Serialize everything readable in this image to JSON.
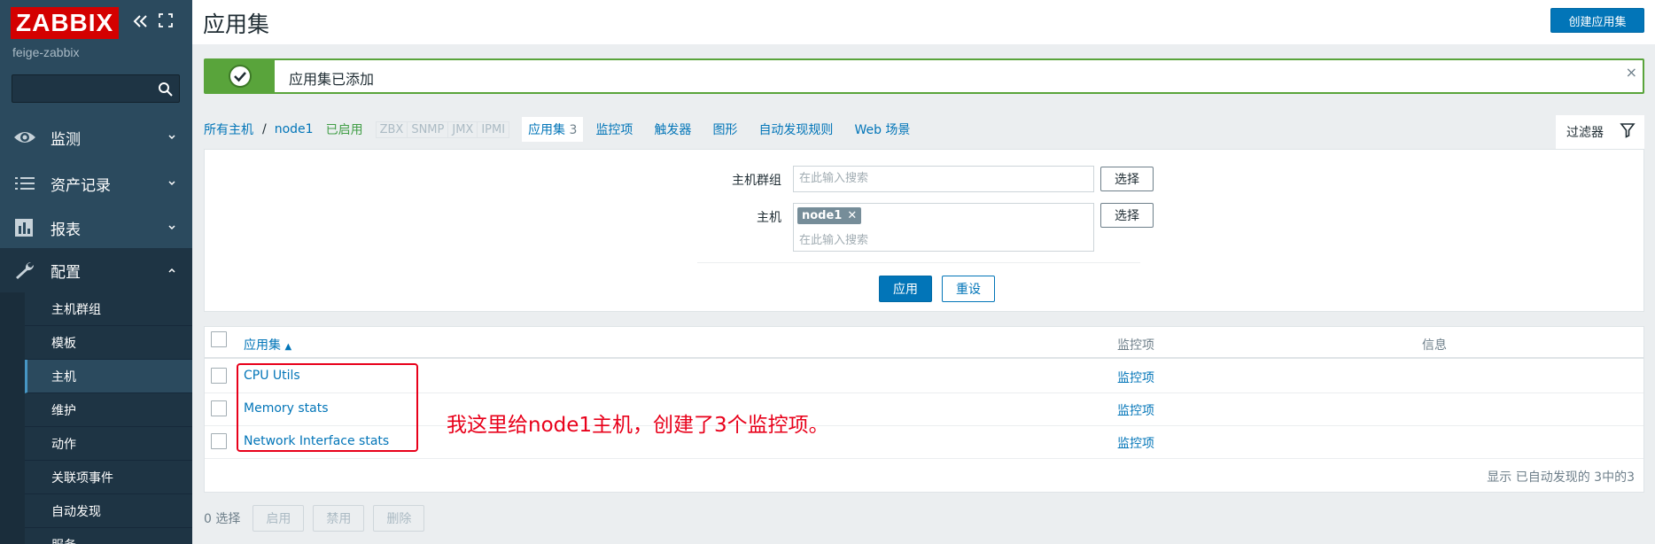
{
  "sidebar": {
    "logo": "ZABBIX",
    "server_name": "feige-zabbix",
    "search_placeholder": "",
    "menu": [
      {
        "label": "监测",
        "icon": "eye-icon"
      },
      {
        "label": "资产记录",
        "icon": "list-icon"
      },
      {
        "label": "报表",
        "icon": "bar-chart-icon"
      },
      {
        "label": "配置",
        "icon": "wrench-icon"
      }
    ],
    "submenu": [
      "主机群组",
      "模板",
      "主机",
      "维护",
      "动作",
      "关联项事件",
      "自动发现",
      "服务"
    ]
  },
  "header": {
    "title": "应用集",
    "create_button": "创建应用集"
  },
  "message": {
    "text": "应用集已添加",
    "close": "×"
  },
  "nav": {
    "all_hosts": "所有主机",
    "separator": "/",
    "host": "node1",
    "status": "已启用",
    "tags": [
      "ZBX",
      "SNMP",
      "JMX",
      "IPMI"
    ],
    "current_tab": "应用集",
    "current_count": "3",
    "links": [
      "监控项",
      "触发器",
      "图形",
      "自动发现规则",
      "Web 场景"
    ]
  },
  "filter": {
    "tab_label": "过滤器",
    "host_group_label": "主机群组",
    "host_label": "主机",
    "search_placeholder": "在此输入搜索",
    "select_button": "选择",
    "host_chip": "node1",
    "chip_remove": "✕",
    "apply": "应用",
    "reset": "重设"
  },
  "table": {
    "headers": {
      "name": "应用集",
      "items": "监控项",
      "info": "信息"
    },
    "rows": [
      {
        "name": "CPU Utils",
        "items": "监控项"
      },
      {
        "name": "Memory stats",
        "items": "监控项"
      },
      {
        "name": "Network Interface stats",
        "items": "监控项"
      }
    ],
    "footer": "显示 已自动发现的 3中的3"
  },
  "annotation": "我这里给node1主机，创建了3个监控项。",
  "bottom": {
    "selected": "0 选择",
    "buttons": [
      "启用",
      "禁用",
      "删除"
    ]
  },
  "colors": {
    "sidebar_bg": "#2b4a5e",
    "accent_blue": "#0275b8",
    "success_green": "#59a43b",
    "annotation_red": "#e8001a",
    "logo_red": "#d40000"
  }
}
